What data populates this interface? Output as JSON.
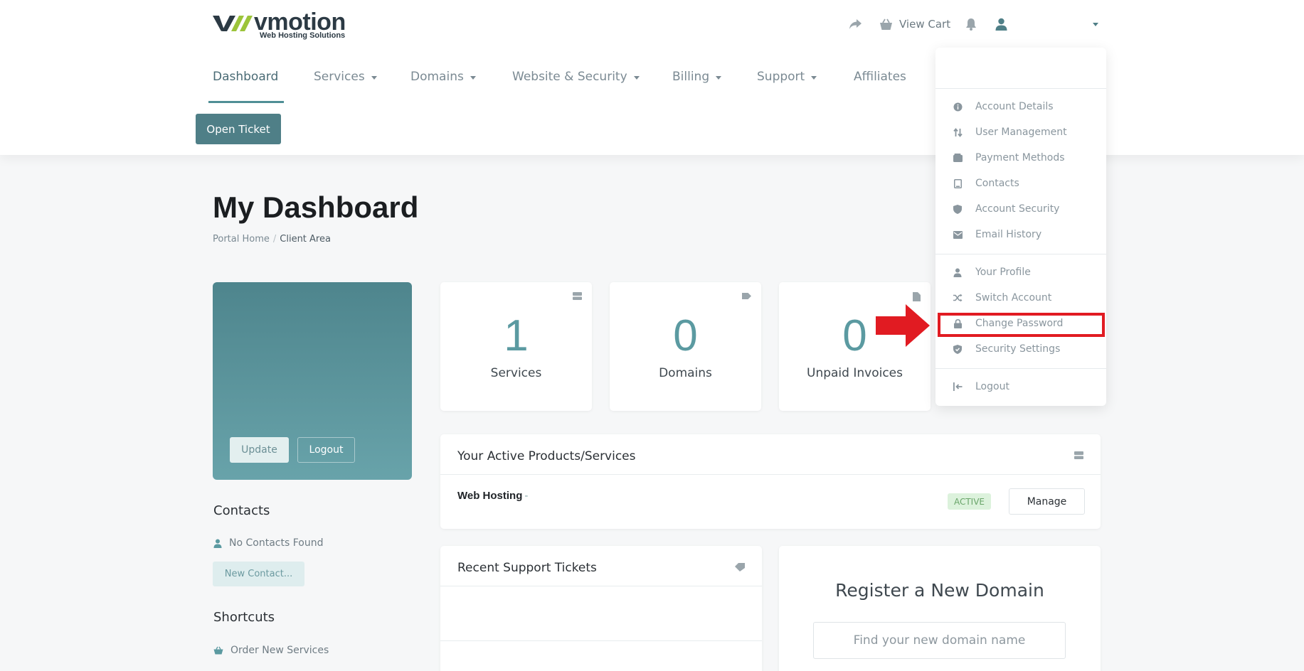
{
  "brand": {
    "name": "vmotion",
    "tagline": "Web Hosting Solutions",
    "colors": {
      "teal": "#4f7f87",
      "teal_light": "#5b9aa1",
      "lime": "#9cc43a",
      "dark": "#2c3a44",
      "highlight": "#e11b22"
    }
  },
  "top_bar": {
    "share_icon": "share-arrow-icon",
    "cart_label": "View Cart",
    "bell_icon": "bell-icon",
    "user_icon": "user-icon",
    "dropdown_icon": "caret-down-icon"
  },
  "nav": {
    "items": [
      {
        "label": "Dashboard",
        "active": true,
        "has_caret": false
      },
      {
        "label": "Services",
        "has_caret": true
      },
      {
        "label": "Domains",
        "has_caret": true
      },
      {
        "label": "Website & Security",
        "has_caret": true
      },
      {
        "label": "Billing",
        "has_caret": true
      },
      {
        "label": "Support",
        "has_caret": true
      },
      {
        "label": "Affiliates",
        "has_caret": false
      }
    ]
  },
  "open_ticket_label": "Open Ticket",
  "page": {
    "title": "My Dashboard",
    "breadcrumb": [
      "Portal Home",
      "Client Area"
    ]
  },
  "profile_card": {
    "update_label": "Update",
    "logout_label": "Logout"
  },
  "contacts": {
    "heading": "Contacts",
    "empty_text": "No Contacts Found",
    "new_button": "New Contact..."
  },
  "shortcuts": {
    "heading": "Shortcuts",
    "items": [
      "Order New Services"
    ]
  },
  "stats": [
    {
      "value": "1",
      "label": "Services",
      "icon": "server-icon"
    },
    {
      "value": "0",
      "label": "Domains",
      "icon": "tag-icon"
    },
    {
      "value": "0",
      "label": "Unpaid Invoices",
      "icon": "document-icon"
    }
  ],
  "products_panel": {
    "title": "Your Active Products/Services",
    "product_name": "Web Hosting",
    "product_dash": "-",
    "status": "ACTIVE",
    "manage_label": "Manage"
  },
  "tickets_panel": {
    "title": "Recent Support Tickets"
  },
  "domain_panel": {
    "title": "Register a New Domain",
    "placeholder": "Find your new domain name"
  },
  "user_menu": {
    "group1": [
      {
        "label": "Account Details",
        "icon": "info-circle-icon"
      },
      {
        "label": "User Management",
        "icon": "arrows-up-down-icon"
      },
      {
        "label": "Payment Methods",
        "icon": "wallet-icon"
      },
      {
        "label": "Contacts",
        "icon": "address-book-icon"
      },
      {
        "label": "Account Security",
        "icon": "shield-icon"
      },
      {
        "label": "Email History",
        "icon": "envelope-icon"
      }
    ],
    "group2": [
      {
        "label": "Your Profile",
        "icon": "user-icon"
      },
      {
        "label": "Switch Account",
        "icon": "shuffle-icon"
      },
      {
        "label": "Change Password",
        "icon": "lock-icon",
        "highlighted": true
      },
      {
        "label": "Security Settings",
        "icon": "shield-check-icon"
      }
    ],
    "group3": [
      {
        "label": "Logout",
        "icon": "logout-icon"
      }
    ]
  }
}
